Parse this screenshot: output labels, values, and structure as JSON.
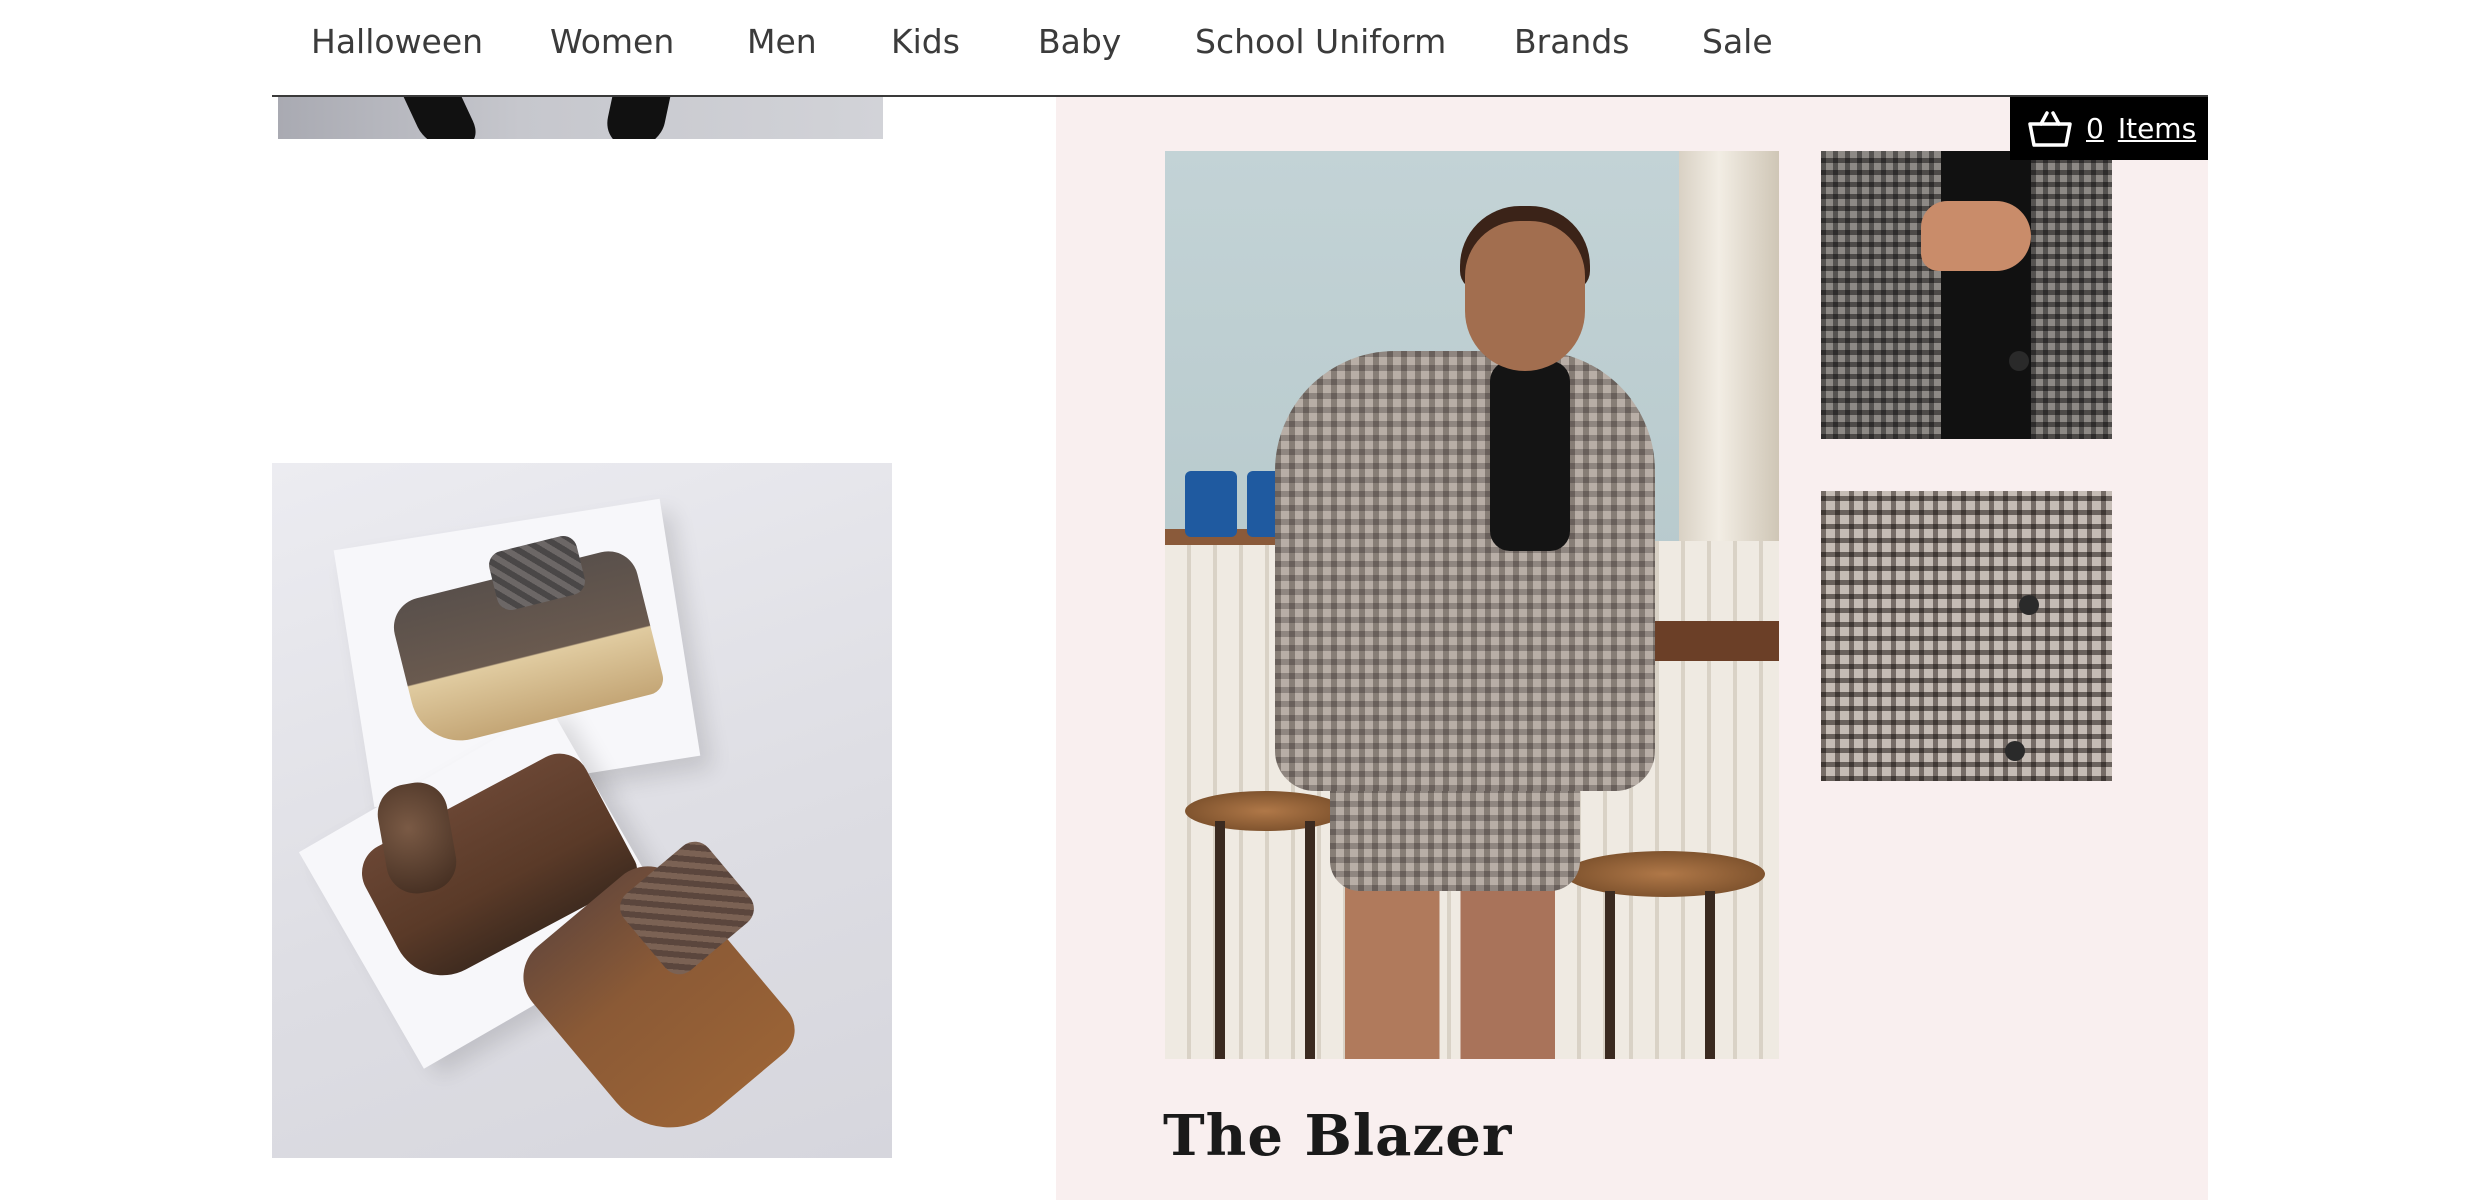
{
  "nav": {
    "items": [
      "Halloween",
      "Women",
      "Men",
      "Kids",
      "Baby",
      "School Uniform",
      "Brands",
      "Sale"
    ]
  },
  "basket": {
    "count": "0",
    "label": "Items",
    "icon": "basket-icon"
  },
  "feature": {
    "title": "The Blazer"
  },
  "colors": {
    "feature_background": "#f9efef",
    "basket_background": "#000000",
    "nav_text": "#3b3b3b"
  }
}
